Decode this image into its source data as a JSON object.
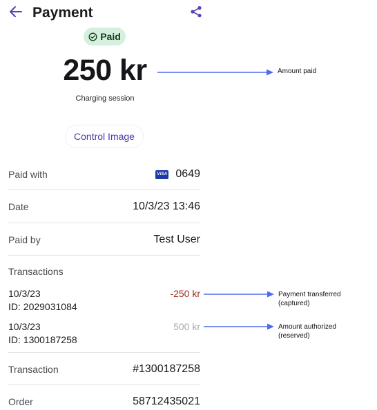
{
  "header": {
    "title": "Payment",
    "back_icon": "arrow-left-icon",
    "share_icon": "share-icon"
  },
  "status_badge": {
    "label": "Paid",
    "color": "#d5f0dd"
  },
  "amount": {
    "value": "250 kr",
    "description": "Charging session"
  },
  "control_button": {
    "label": "Control Image"
  },
  "details": {
    "paid_with": {
      "label": "Paid with",
      "card_brand": "VISA",
      "last4": "0649"
    },
    "date": {
      "label": "Date",
      "value": "10/3/23 13:46"
    },
    "paid_by": {
      "label": "Paid by",
      "value": "Test User"
    }
  },
  "transactions": {
    "title": "Transactions",
    "items": [
      {
        "date": "10/3/23",
        "id": "ID: 2029031084",
        "amount": "-250 kr"
      },
      {
        "date": "10/3/23",
        "id": "ID: 1300187258",
        "amount": "500 kr"
      }
    ]
  },
  "footer_rows": {
    "transaction": {
      "label": "Transaction",
      "value": "#1300187258"
    },
    "order": {
      "label": "Order",
      "value": "58712435021"
    }
  },
  "annotations": {
    "amount_paid": "Amount paid",
    "payment_transferred_line1": "Payment transferred",
    "payment_transferred_line2": "(captured)",
    "amount_authorized_line1": "Amount authorized",
    "amount_authorized_line2": "(reserved)"
  },
  "colors": {
    "accent": "#5b3fb5",
    "negative": "#9d2b1a",
    "muted": "#a9a9b3",
    "arrow": "#4a6cf0"
  }
}
